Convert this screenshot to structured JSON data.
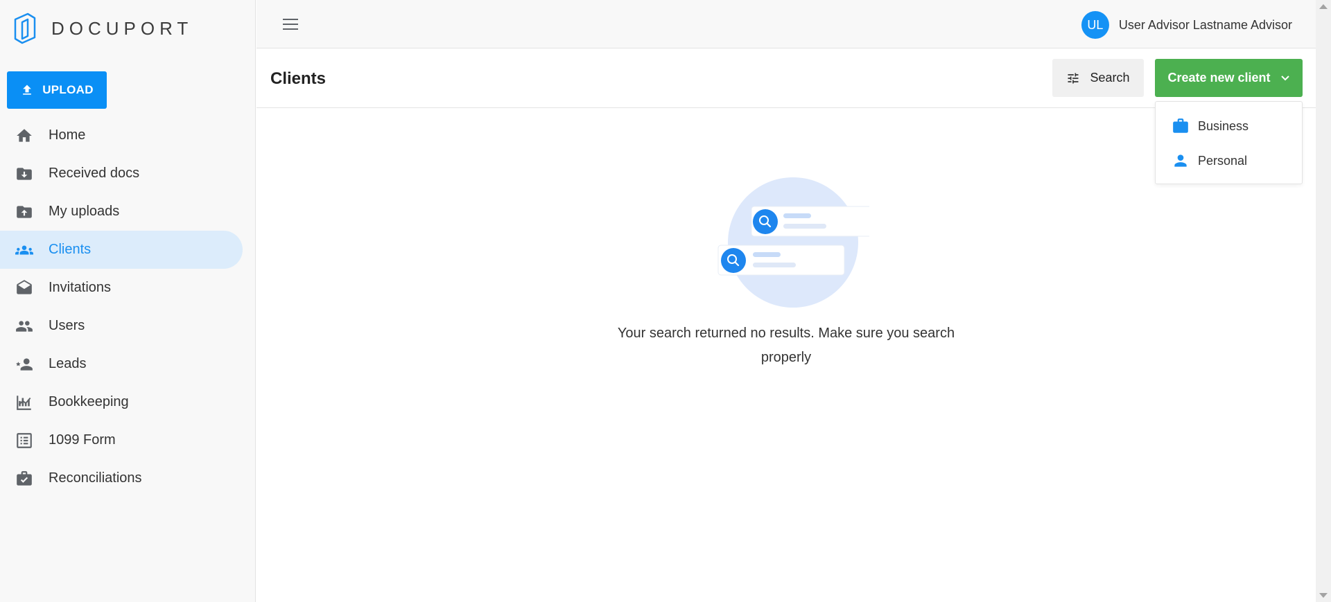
{
  "brand": {
    "name": "DOCUPORT"
  },
  "sidebar": {
    "upload_label": "UPLOAD",
    "items": [
      {
        "label": "Home",
        "icon": "home-icon"
      },
      {
        "label": "Received docs",
        "icon": "folder-download-icon"
      },
      {
        "label": "My uploads",
        "icon": "folder-upload-icon"
      },
      {
        "label": "Clients",
        "icon": "groups-icon",
        "active": true
      },
      {
        "label": "Invitations",
        "icon": "drafts-icon"
      },
      {
        "label": "Users",
        "icon": "people-icon"
      },
      {
        "label": "Leads",
        "icon": "person-star-icon"
      },
      {
        "label": "Bookkeeping",
        "icon": "chart-icon"
      },
      {
        "label": "1099 Form",
        "icon": "list-form-icon"
      },
      {
        "label": "Reconciliations",
        "icon": "briefcase-check-icon"
      }
    ]
  },
  "topbar": {
    "user_initials": "UL",
    "user_name": "User Advisor Lastname Advisor"
  },
  "page": {
    "title": "Clients",
    "search_label": "Search",
    "create_label": "Create new client"
  },
  "dropdown": {
    "items": [
      {
        "label": "Business",
        "icon": "briefcase-icon"
      },
      {
        "label": "Personal",
        "icon": "person-icon"
      }
    ]
  },
  "empty_state": {
    "message": "Your search returned no results. Make sure you search properly"
  },
  "colors": {
    "primary": "#0a8ff5",
    "success": "#4cb050",
    "active_bg": "#dcecfb"
  }
}
